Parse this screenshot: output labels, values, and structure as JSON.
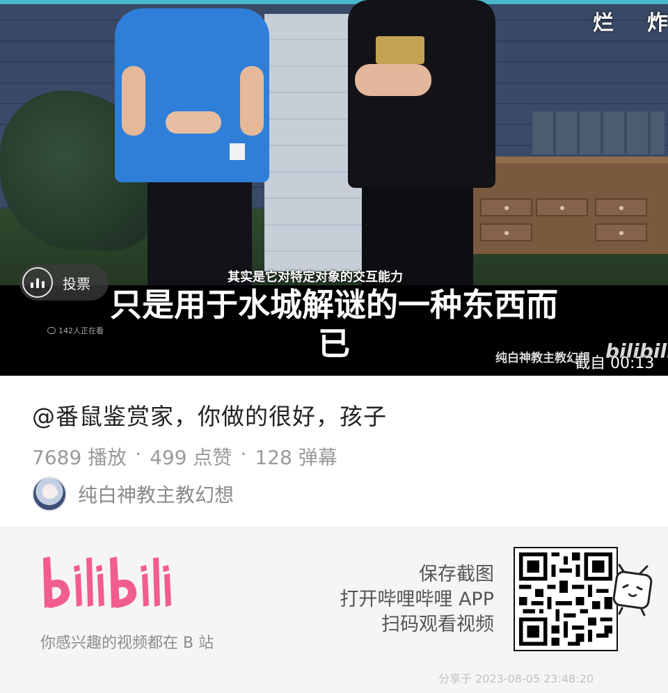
{
  "video": {
    "danmaku": [
      "烂",
      "炸"
    ],
    "vote_label": "投票",
    "subtitle_small": "其实是它对特定对象的交互能力",
    "subtitle_big_line1": "只是用于水城解谜的一种东西而",
    "subtitle_big_line2": "已",
    "watching": "142人正在看",
    "channel_watermark": "纯白神教主教幻想",
    "brand_watermark": "bilibili",
    "screenshot_time": "截自 00:13"
  },
  "info": {
    "title": "@番鼠鉴赏家，你做的很好，孩子",
    "plays": "7689 播放",
    "likes": "499 点赞",
    "danmaku_count": "128 弹幕",
    "separator": "·",
    "author": "纯白神教主教幻想"
  },
  "share": {
    "logo_text": "bilibili",
    "slogan": "你感兴趣的视频都在 B 站",
    "promo_line1": "保存截图",
    "promo_line2": "打开哔哩哔哩 APP",
    "promo_line3": "扫码观看视频",
    "shared_at": "分享于 2023-08-05 23:48:20",
    "brand_color": "#f25d8e"
  }
}
